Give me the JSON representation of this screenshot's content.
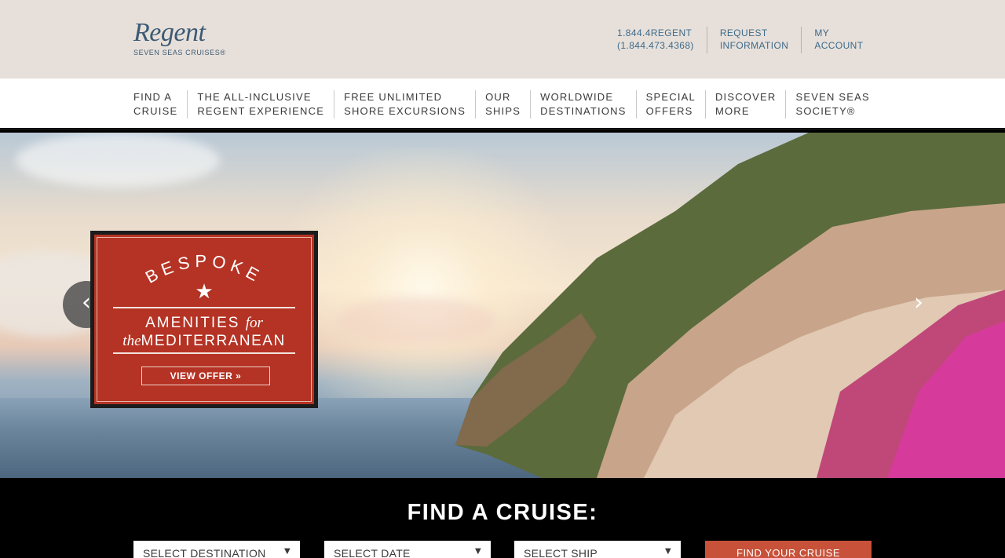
{
  "brand": {
    "name": "Regent",
    "tagline": "SEVEN SEAS CRUISES®"
  },
  "utility": [
    {
      "line1": "1.844.4REGENT",
      "line2": "(1.844.473.4368)"
    },
    {
      "line1": "REQUEST",
      "line2": "INFORMATION"
    },
    {
      "line1": "MY",
      "line2": "ACCOUNT"
    }
  ],
  "nav": [
    {
      "line1": "FIND A",
      "line2": "CRUISE"
    },
    {
      "line1": "THE ALL-INCLUSIVE",
      "line2": "REGENT EXPERIENCE"
    },
    {
      "line1": "FREE UNLIMITED",
      "line2": "SHORE EXCURSIONS"
    },
    {
      "line1": "OUR",
      "line2": "SHIPS"
    },
    {
      "line1": "WORLDWIDE",
      "line2": "DESTINATIONS"
    },
    {
      "line1": "SPECIAL",
      "line2": "OFFERS"
    },
    {
      "line1": "DISCOVER",
      "line2": "MORE"
    },
    {
      "line1": "SEVEN SEAS",
      "line2": "SOCIETY®"
    }
  ],
  "hero": {
    "prev_icon": "chevron-left",
    "next_icon": "chevron-right",
    "offer": {
      "arc_text": "BESPOKE",
      "line1_a": "AMENITIES",
      "line1_b": "for",
      "line2_a": "the",
      "line2_b": "MEDITERRANEAN",
      "button": "VIEW OFFER »"
    }
  },
  "finder": {
    "title": "FIND A CRUISE:",
    "destination": "SELECT DESTINATION",
    "date": "SELECT DATE",
    "ship": "SELECT SHIP",
    "button": "FIND YOUR CRUISE"
  },
  "colors": {
    "accent": "#c75239",
    "offer_red": "#b53324",
    "brand_blue": "#3c5a74"
  }
}
